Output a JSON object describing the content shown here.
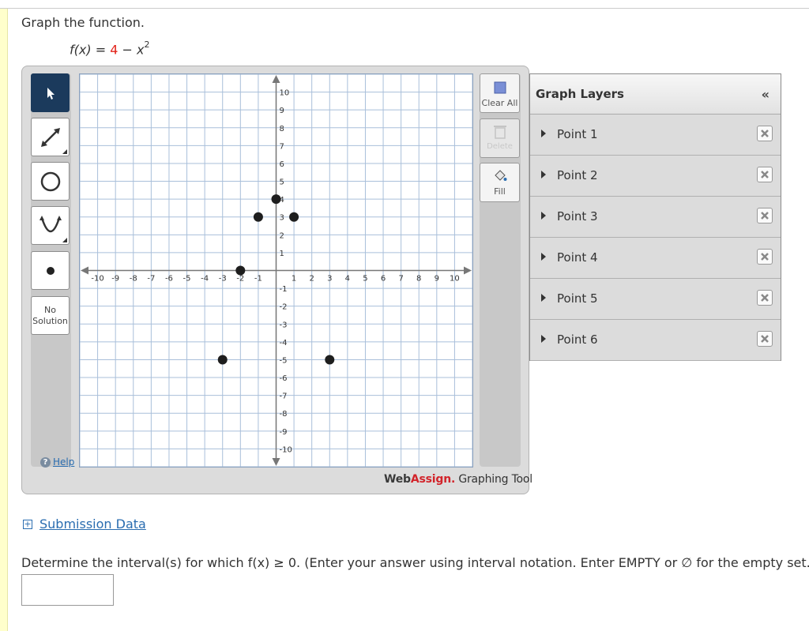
{
  "prompt": "Graph the function.",
  "formula": {
    "lhs": "f(x)",
    "equals": "=",
    "constant": "4",
    "minus": "−",
    "var": "x",
    "exponent": "2"
  },
  "toolbar": {
    "tools": [
      "pointer",
      "line",
      "circle",
      "parabola",
      "point"
    ],
    "no_solution": [
      "No",
      "Solution"
    ],
    "help": "Help"
  },
  "side_buttons": {
    "clear_all": "Clear All",
    "delete": "Delete",
    "fill": "Fill"
  },
  "brand": {
    "web": "Web",
    "assign": "Assign.",
    "tool": " Graphing Tool"
  },
  "graph": {
    "x_range": [
      -11,
      11
    ],
    "y_range": [
      -11,
      11
    ],
    "x_ticks": [
      "-10",
      "-9",
      "-8",
      "-7",
      "-6",
      "-5",
      "-4",
      "-3",
      "-2",
      "-1",
      "1",
      "2",
      "3",
      "4",
      "5",
      "6",
      "7",
      "8",
      "9",
      "10"
    ],
    "y_ticks": [
      "10",
      "9",
      "8",
      "7",
      "6",
      "5",
      "4",
      "3",
      "2",
      "1",
      "-1",
      "-2",
      "-3",
      "-4",
      "-5",
      "-6",
      "-7",
      "-8",
      "-9",
      "-10"
    ],
    "points": [
      {
        "x": 0,
        "y": 4
      },
      {
        "x": -1,
        "y": 3
      },
      {
        "x": 1,
        "y": 3
      },
      {
        "x": -2,
        "y": 0
      },
      {
        "x": -3,
        "y": -5
      },
      {
        "x": 3,
        "y": -5
      }
    ]
  },
  "layers": {
    "title": "Graph Layers",
    "collapse": "«",
    "items": [
      "Point 1",
      "Point 2",
      "Point 3",
      "Point 4",
      "Point 5",
      "Point 6"
    ]
  },
  "submission_data": "Submission Data",
  "question": "Determine the interval(s) for which f(x) ≥ 0. (Enter your answer using interval notation. Enter EMPTY or ∅ for the empty set.)",
  "answer_value": ""
}
